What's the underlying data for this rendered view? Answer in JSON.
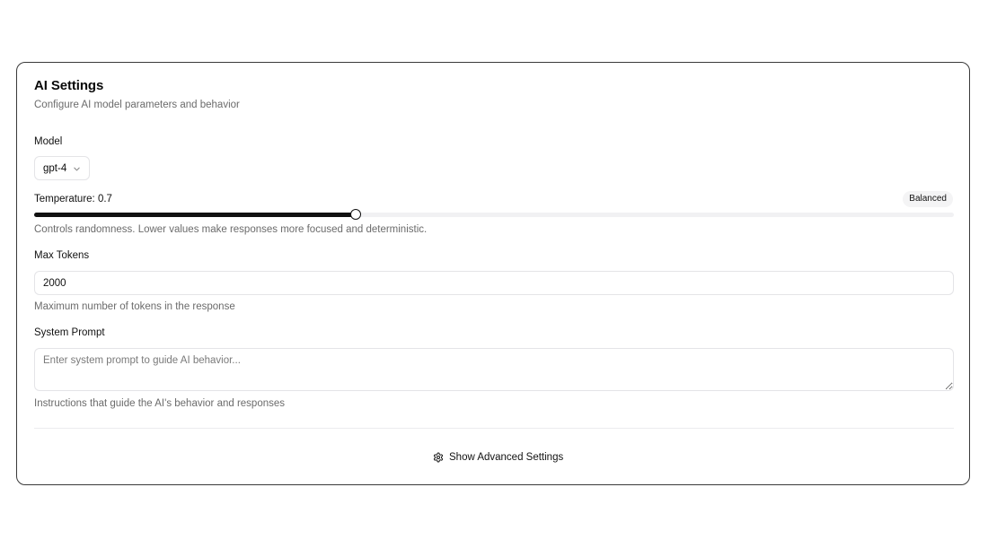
{
  "header": {
    "title": "AI Settings",
    "subtitle": "Configure AI model parameters and behavior"
  },
  "model": {
    "label": "Model",
    "selected": "gpt-4"
  },
  "temperature": {
    "label_prefix": "Temperature: ",
    "value": 0.7,
    "display": "Temperature: 0.7",
    "badge": "Balanced",
    "help": "Controls randomness. Lower values make responses more focused and deterministic.",
    "slider_fraction": 0.35
  },
  "max_tokens": {
    "label": "Max Tokens",
    "value": "2000",
    "help": "Maximum number of tokens in the response"
  },
  "system_prompt": {
    "label": "System Prompt",
    "value": "",
    "placeholder": "Enter system prompt to guide AI behavior...",
    "help": "Instructions that guide the AI's behavior and responses"
  },
  "advanced": {
    "button_label": "Show Advanced Settings",
    "icon": "gear-icon"
  }
}
